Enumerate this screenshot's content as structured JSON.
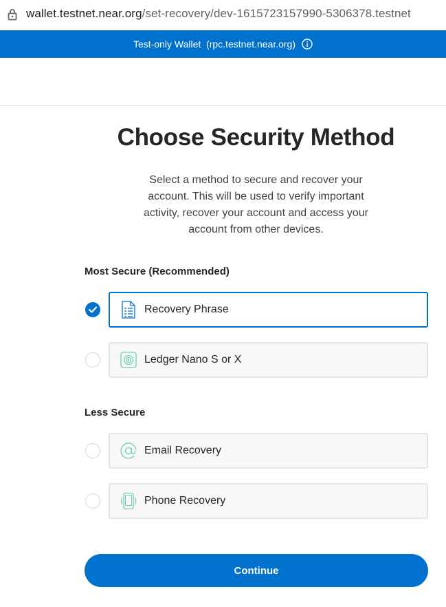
{
  "browser": {
    "url_host": "wallet.testnet.near.org",
    "url_path": "/set-recovery/dev-1615723157990-5306378.testnet"
  },
  "banner": {
    "text": "Test-only Wallet  (rpc.testnet.near.org)"
  },
  "page": {
    "title": "Choose Security Method",
    "description": "Select a method to secure and recover your account. This will be used to verify important activity, recover your account and access your account from other devices."
  },
  "sections": {
    "most_secure_label": "Most Secure (Recommended)",
    "less_secure_label": "Less Secure"
  },
  "options": {
    "recovery_phrase": {
      "label": "Recovery Phrase",
      "selected": true,
      "icon": "document-icon"
    },
    "ledger": {
      "label": "Ledger Nano S or X",
      "selected": false,
      "icon": "ledger-icon"
    },
    "email": {
      "label": "Email Recovery",
      "selected": false,
      "icon": "at-icon"
    },
    "phone": {
      "label": "Phone Recovery",
      "selected": false,
      "icon": "phone-icon"
    }
  },
  "actions": {
    "continue_label": "Continue"
  },
  "colors": {
    "accent": "#0072ce",
    "icon_green": "#6ad1a8",
    "icon_blue": "#0072ce"
  }
}
